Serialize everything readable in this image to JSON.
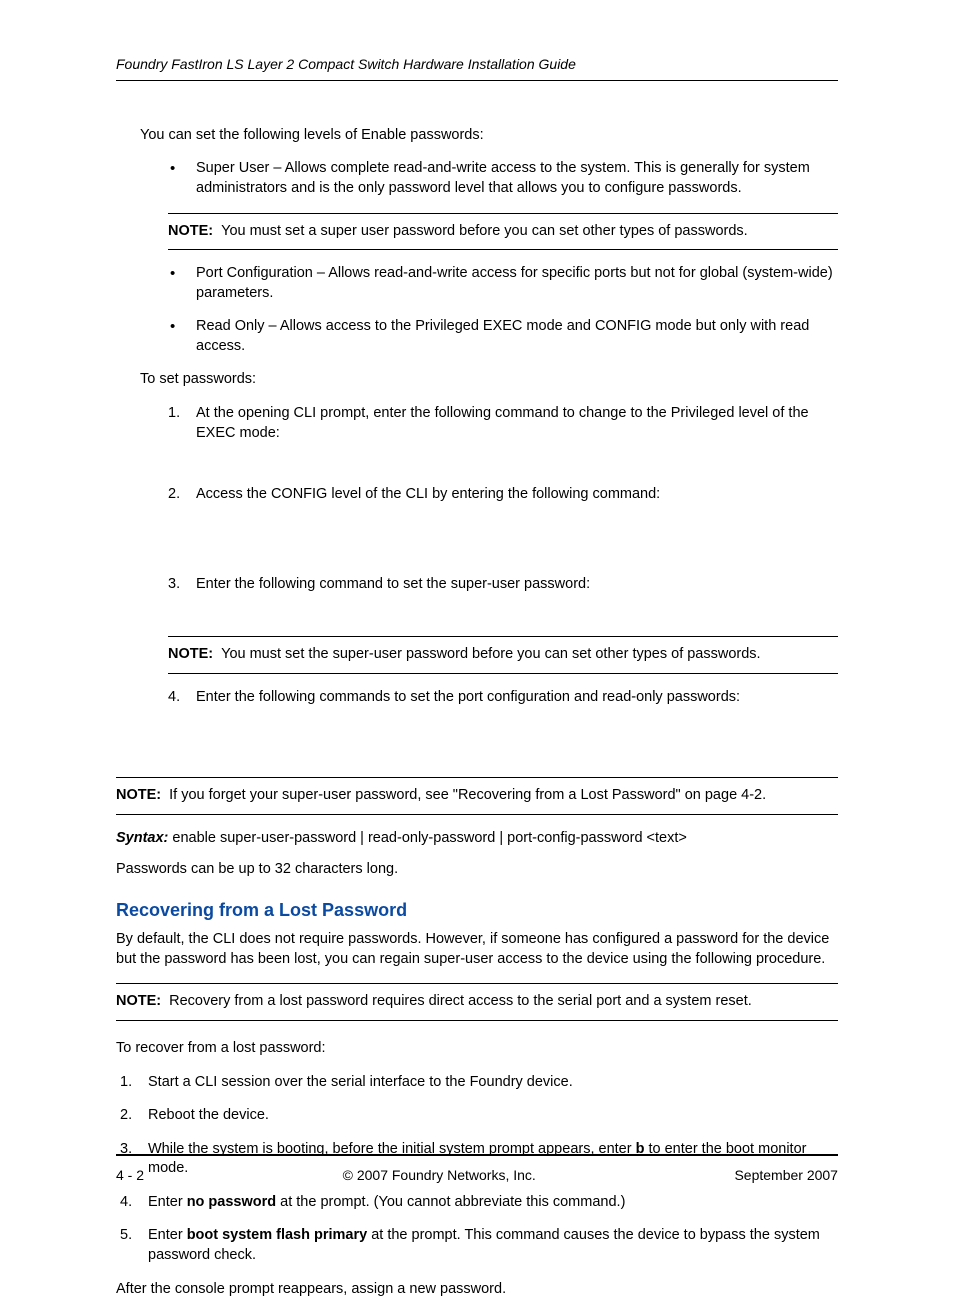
{
  "header": {
    "title": "Foundry FastIron LS Layer 2 Compact Switch Hardware Installation Guide"
  },
  "intro": "You can set the following levels of Enable passwords:",
  "levels": {
    "super_user": "Super User – Allows complete read-and-write access to the system.  This is generally for system administrators and is the only password level that allows you to configure passwords.",
    "port_config": "Port Configuration – Allows read-and-write access for specific ports but not for global (system-wide) parameters.",
    "read_only": "Read Only – Allows access to the Privileged EXEC mode and CONFIG mode but only with read access."
  },
  "notes": {
    "label": "NOTE:",
    "n1": "You must set a super user password before you can set other types of passwords.",
    "n2": "You must set the super-user password before you can set other types of passwords.",
    "n3": "If you forget your super-user password, see \"Recovering from a Lost Password\" on page 4-2.",
    "n4": "Recovery from a lost password requires direct access to the serial port and a system reset."
  },
  "to_set": "To set passwords:",
  "steps_set": {
    "s1": "At the opening CLI prompt, enter the following command to change to the Privileged level of the EXEC mode:",
    "s2": "Access the CONFIG level of the CLI by entering the following command:",
    "s3": "Enter the following command to set the super-user password:",
    "s4": "Enter the following commands to set the port configuration and read-only passwords:"
  },
  "syntax": {
    "label": "Syntax:",
    "text": "enable super-user-password | read-only-password | port-config-password <text>"
  },
  "pw_len": "Passwords can be up to 32 characters long.",
  "section2": {
    "heading": "Recovering from a Lost Password",
    "intro": "By default, the CLI does not require passwords.  However, if someone has configured a password for the device but the password has been lost, you can regain super-user access to the device using the following procedure.",
    "to_recover": "To recover from a lost password:",
    "steps": {
      "s1": "Start a CLI session over the serial interface to the Foundry device.",
      "s2": "Reboot the device.",
      "s3_a": "While the system is booting, before the initial system prompt appears, enter ",
      "s3_bold": "b",
      "s3_b": " to enter the boot monitor mode.",
      "s4_a": "Enter ",
      "s4_bold": "no password",
      "s4_b": " at the prompt.  (You cannot abbreviate this command.)",
      "s5_a": "Enter ",
      "s5_bold": "boot system flash primary",
      "s5_b": " at the prompt.  This command causes the device to bypass the system password check."
    },
    "after": "After the console prompt reappears, assign a new password."
  },
  "footer": {
    "left": "4 - 2",
    "center": "© 2007 Foundry Networks, Inc.",
    "right": "September 2007"
  }
}
